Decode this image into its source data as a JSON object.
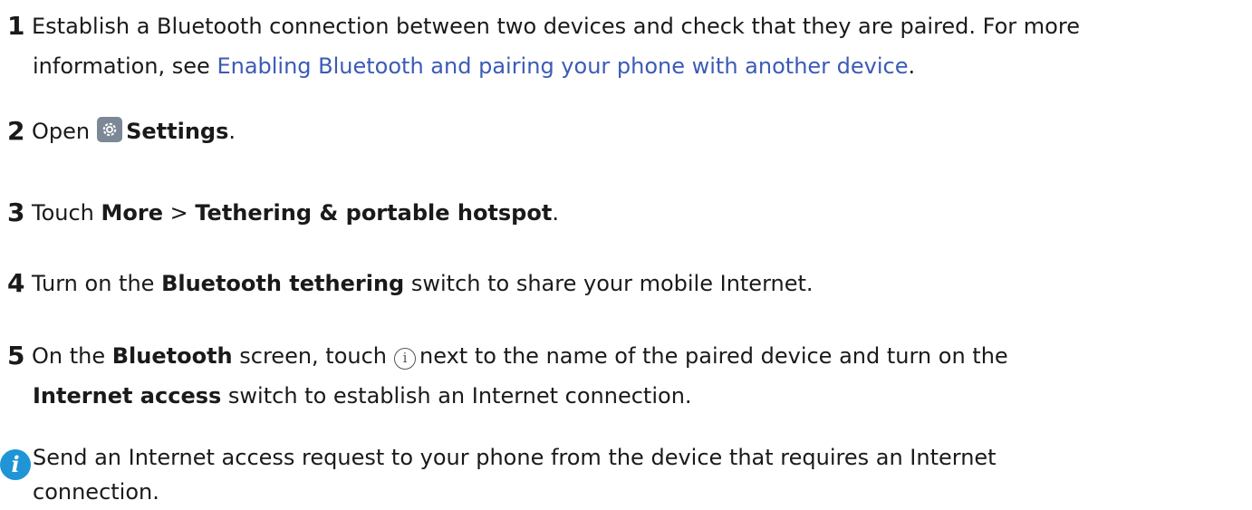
{
  "steps": [
    {
      "num": "1",
      "t1": "Establish a Bluetooth connection between two devices and check that they are paired. For more",
      "t2": "information, see ",
      "link": "Enabling Bluetooth and pairing your phone with another device",
      "t3": "."
    },
    {
      "num": "2",
      "t1": "Open",
      "icon": "settings-gear-icon",
      "bold": "Settings",
      "t2": "."
    },
    {
      "num": "3",
      "t1": "Touch ",
      "bold1": "More",
      "sep": " > ",
      "bold2": "Tethering & portable hotspot",
      "t2": "."
    },
    {
      "num": "4",
      "t1": "Turn on the ",
      "bold": "Bluetooth tethering",
      "t2": " switch to share your mobile Internet."
    },
    {
      "num": "5",
      "t1": "On the ",
      "bold1": "Bluetooth",
      "t2": " screen, touch",
      "icon": "info-i-icon",
      "info_glyph": "i",
      "t3": "next to the name of the paired device and turn on the",
      "bold2": "Internet access",
      "t4": " switch to establish an Internet connection."
    }
  ],
  "note": {
    "icon": "info-note-icon",
    "glyph": "i",
    "text1": "Send an Internet access request to your phone from the device that requires an Internet",
    "text2": "connection."
  },
  "colors": {
    "link": "#3b5bb5",
    "note_icon": "#1f95d6",
    "settings_icon": "#7c8896"
  }
}
